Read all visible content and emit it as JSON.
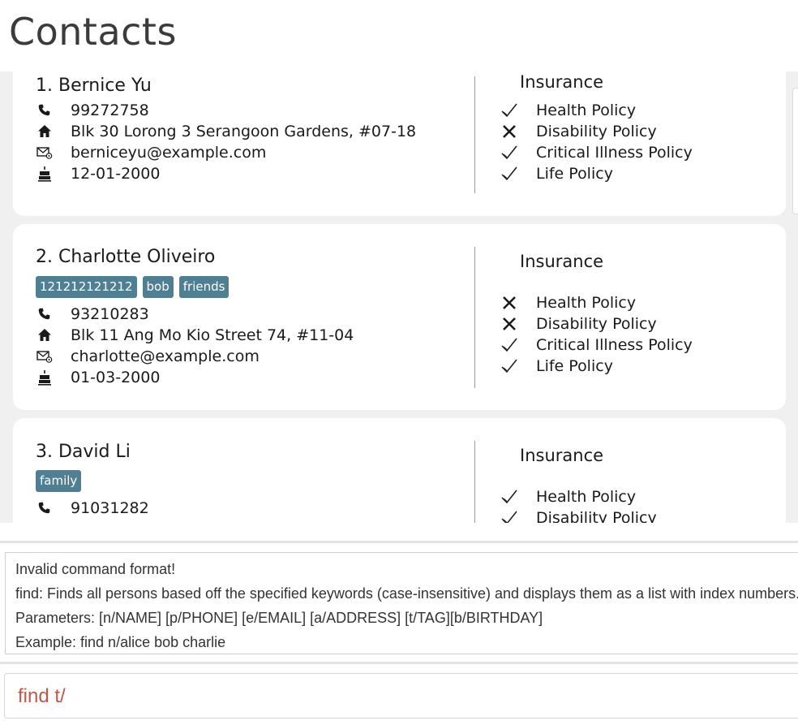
{
  "header": {
    "title": "Contacts"
  },
  "insurance_heading": "Insurance",
  "persons": [
    {
      "index_name": "1.  Bernice Yu",
      "tags": [],
      "phone": "99272758",
      "address": "Blk 30 Lorong 3 Serangoon Gardens, #07-18",
      "email": "berniceyu@example.com",
      "birthday": "12-01-2000",
      "policies": [
        {
          "name": "Health Policy",
          "status": "check"
        },
        {
          "name": "Disability Policy",
          "status": "cross"
        },
        {
          "name": "Critical Illness Policy",
          "status": "check"
        },
        {
          "name": "Life Policy",
          "status": "check"
        }
      ]
    },
    {
      "index_name": "2.  Charlotte Oliveiro",
      "tags": [
        "121212121212",
        "bob",
        "friends"
      ],
      "phone": "93210283",
      "address": "Blk 11 Ang Mo Kio Street 74, #11-04",
      "email": "charlotte@example.com",
      "birthday": "01-03-2000",
      "policies": [
        {
          "name": "Health Policy",
          "status": "cross"
        },
        {
          "name": "Disability Policy",
          "status": "cross"
        },
        {
          "name": "Critical Illness Policy",
          "status": "check"
        },
        {
          "name": "Life Policy",
          "status": "check"
        }
      ]
    },
    {
      "index_name": "3.  David Li",
      "tags": [
        "family"
      ],
      "phone": "91031282",
      "policies": [
        {
          "name": "Health Policy",
          "status": "check"
        },
        {
          "name": "Disability Policy",
          "status": "check"
        }
      ]
    }
  ],
  "icons": {
    "phone": "phone-icon",
    "address": "home-icon",
    "email": "email-icon",
    "birthday": "birthday-cake-icon",
    "check": "check-icon",
    "cross": "cross-icon"
  },
  "result": {
    "lines": [
      "Invalid command format!",
      "find: Finds all persons based off the specified keywords (case-insensitive) and displays them as a list with index numbers.",
      "Parameters: [n/NAME] [p/PHONE] [e/EMAIL] [a/ADDRESS] [t/TAG][b/BIRTHDAY]",
      "Example: find n/alice bob charlie"
    ]
  },
  "command": {
    "value": "find t/"
  },
  "colors": {
    "tag_bg": "#4f7f93",
    "command_text": "#c0574a",
    "list_bg": "#f0f0f0"
  }
}
